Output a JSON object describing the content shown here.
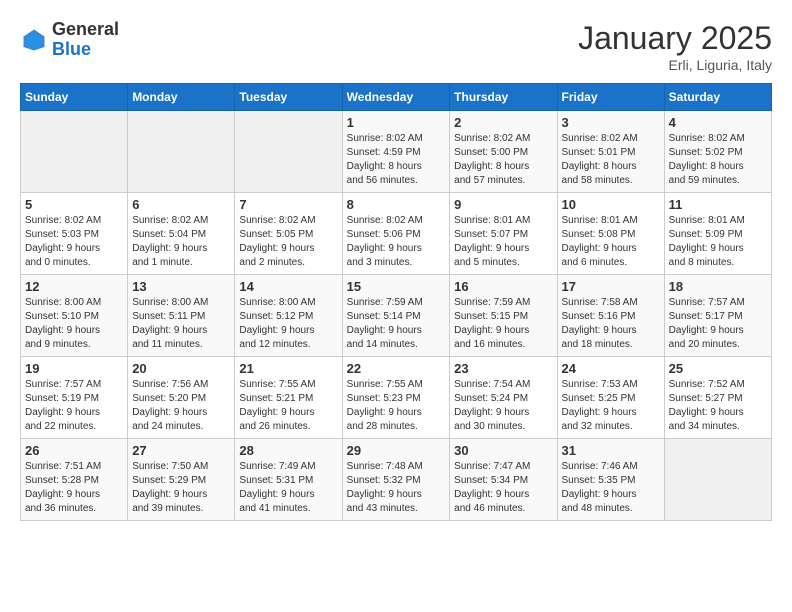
{
  "logo": {
    "general": "General",
    "blue": "Blue"
  },
  "header": {
    "month_title": "January 2025",
    "subtitle": "Erli, Liguria, Italy"
  },
  "weekdays": [
    "Sunday",
    "Monday",
    "Tuesday",
    "Wednesday",
    "Thursday",
    "Friday",
    "Saturday"
  ],
  "weeks": [
    [
      {
        "day": "",
        "info": ""
      },
      {
        "day": "",
        "info": ""
      },
      {
        "day": "",
        "info": ""
      },
      {
        "day": "1",
        "info": "Sunrise: 8:02 AM\nSunset: 4:59 PM\nDaylight: 8 hours\nand 56 minutes."
      },
      {
        "day": "2",
        "info": "Sunrise: 8:02 AM\nSunset: 5:00 PM\nDaylight: 8 hours\nand 57 minutes."
      },
      {
        "day": "3",
        "info": "Sunrise: 8:02 AM\nSunset: 5:01 PM\nDaylight: 8 hours\nand 58 minutes."
      },
      {
        "day": "4",
        "info": "Sunrise: 8:02 AM\nSunset: 5:02 PM\nDaylight: 8 hours\nand 59 minutes."
      }
    ],
    [
      {
        "day": "5",
        "info": "Sunrise: 8:02 AM\nSunset: 5:03 PM\nDaylight: 9 hours\nand 0 minutes."
      },
      {
        "day": "6",
        "info": "Sunrise: 8:02 AM\nSunset: 5:04 PM\nDaylight: 9 hours\nand 1 minute."
      },
      {
        "day": "7",
        "info": "Sunrise: 8:02 AM\nSunset: 5:05 PM\nDaylight: 9 hours\nand 2 minutes."
      },
      {
        "day": "8",
        "info": "Sunrise: 8:02 AM\nSunset: 5:06 PM\nDaylight: 9 hours\nand 3 minutes."
      },
      {
        "day": "9",
        "info": "Sunrise: 8:01 AM\nSunset: 5:07 PM\nDaylight: 9 hours\nand 5 minutes."
      },
      {
        "day": "10",
        "info": "Sunrise: 8:01 AM\nSunset: 5:08 PM\nDaylight: 9 hours\nand 6 minutes."
      },
      {
        "day": "11",
        "info": "Sunrise: 8:01 AM\nSunset: 5:09 PM\nDaylight: 9 hours\nand 8 minutes."
      }
    ],
    [
      {
        "day": "12",
        "info": "Sunrise: 8:00 AM\nSunset: 5:10 PM\nDaylight: 9 hours\nand 9 minutes."
      },
      {
        "day": "13",
        "info": "Sunrise: 8:00 AM\nSunset: 5:11 PM\nDaylight: 9 hours\nand 11 minutes."
      },
      {
        "day": "14",
        "info": "Sunrise: 8:00 AM\nSunset: 5:12 PM\nDaylight: 9 hours\nand 12 minutes."
      },
      {
        "day": "15",
        "info": "Sunrise: 7:59 AM\nSunset: 5:14 PM\nDaylight: 9 hours\nand 14 minutes."
      },
      {
        "day": "16",
        "info": "Sunrise: 7:59 AM\nSunset: 5:15 PM\nDaylight: 9 hours\nand 16 minutes."
      },
      {
        "day": "17",
        "info": "Sunrise: 7:58 AM\nSunset: 5:16 PM\nDaylight: 9 hours\nand 18 minutes."
      },
      {
        "day": "18",
        "info": "Sunrise: 7:57 AM\nSunset: 5:17 PM\nDaylight: 9 hours\nand 20 minutes."
      }
    ],
    [
      {
        "day": "19",
        "info": "Sunrise: 7:57 AM\nSunset: 5:19 PM\nDaylight: 9 hours\nand 22 minutes."
      },
      {
        "day": "20",
        "info": "Sunrise: 7:56 AM\nSunset: 5:20 PM\nDaylight: 9 hours\nand 24 minutes."
      },
      {
        "day": "21",
        "info": "Sunrise: 7:55 AM\nSunset: 5:21 PM\nDaylight: 9 hours\nand 26 minutes."
      },
      {
        "day": "22",
        "info": "Sunrise: 7:55 AM\nSunset: 5:23 PM\nDaylight: 9 hours\nand 28 minutes."
      },
      {
        "day": "23",
        "info": "Sunrise: 7:54 AM\nSunset: 5:24 PM\nDaylight: 9 hours\nand 30 minutes."
      },
      {
        "day": "24",
        "info": "Sunrise: 7:53 AM\nSunset: 5:25 PM\nDaylight: 9 hours\nand 32 minutes."
      },
      {
        "day": "25",
        "info": "Sunrise: 7:52 AM\nSunset: 5:27 PM\nDaylight: 9 hours\nand 34 minutes."
      }
    ],
    [
      {
        "day": "26",
        "info": "Sunrise: 7:51 AM\nSunset: 5:28 PM\nDaylight: 9 hours\nand 36 minutes."
      },
      {
        "day": "27",
        "info": "Sunrise: 7:50 AM\nSunset: 5:29 PM\nDaylight: 9 hours\nand 39 minutes."
      },
      {
        "day": "28",
        "info": "Sunrise: 7:49 AM\nSunset: 5:31 PM\nDaylight: 9 hours\nand 41 minutes."
      },
      {
        "day": "29",
        "info": "Sunrise: 7:48 AM\nSunset: 5:32 PM\nDaylight: 9 hours\nand 43 minutes."
      },
      {
        "day": "30",
        "info": "Sunrise: 7:47 AM\nSunset: 5:34 PM\nDaylight: 9 hours\nand 46 minutes."
      },
      {
        "day": "31",
        "info": "Sunrise: 7:46 AM\nSunset: 5:35 PM\nDaylight: 9 hours\nand 48 minutes."
      },
      {
        "day": "",
        "info": ""
      }
    ]
  ]
}
